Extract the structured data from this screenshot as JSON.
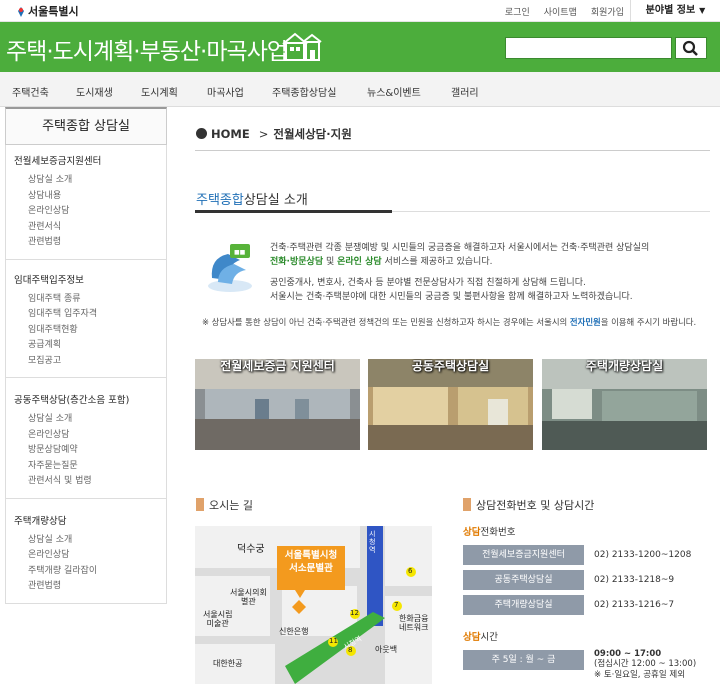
{
  "header": {
    "logo": "서울특별시",
    "site_title": "주택·도시계획·부동산·마곡사업",
    "links": [
      "로그인",
      "사이트맵",
      "회원가입"
    ],
    "info_button": "분야별 정보"
  },
  "nav": [
    "주택건축",
    "도시재생",
    "도시계획",
    "마곡사업",
    "주택종합상담실",
    "뉴스&이벤트",
    "갤러리"
  ],
  "sidebar": {
    "title": "주택종합 상담실",
    "groups": [
      {
        "title": "전월세보증금지원센터",
        "items": [
          "상담실 소개",
          "상담내용",
          "온라인상담",
          "관련서식",
          "관련법령"
        ]
      },
      {
        "title": "임대주택입주정보",
        "items": [
          "임대주택 종류",
          "임대주택 입주자격",
          "임대주택현황",
          "공급계획",
          "모집공고"
        ]
      },
      {
        "title": "공동주택상담(층간소음 포함)",
        "items": [
          "상담실 소개",
          "온라인상담",
          "방문상담예약",
          "자주묻는질문",
          "관련서식 및 법령"
        ]
      },
      {
        "title": "주택개량상담",
        "items": [
          "상담실 소개",
          "온라인상담",
          "주택개량 길라잡이",
          "관련법령"
        ]
      }
    ]
  },
  "breadcrumb": {
    "home": "HOME",
    "sep": ">",
    "current": "전월세상담·지원"
  },
  "section": {
    "title_hl": "주택종합",
    "title_rest": "상담실 소개"
  },
  "intro": {
    "p1a": "건축·주택관련 각종 분쟁예방 및 시민들의 궁금증을 해결하고자 서울시에서는 건축·주택관련 상담실의",
    "p1b_hl1": "전화·방문상담",
    "p1b_mid": " 및 ",
    "p1b_hl2": "온라인 상담",
    "p1b_end": " 서비스를 제공하고 있습니다.",
    "p2": "공인중개사, 변호사, 건축사 등 분야별 전문상담사가 직접 친절하게 상담해 드립니다.",
    "p3": "서울시는 건축·주택분야에 대한 시민들의 궁금증 및 불편사항을 함께 해결하고자 노력하겠습니다."
  },
  "note": {
    "a": "※ 상담사를 통한 상담이 아닌 건축·주택관련 정책건의 또는 민원을 신청하고자 하시는 경우에는 서울시의 ",
    "link": "전자민원",
    "b": "을 이용해 주시기 바랍니다."
  },
  "photos": [
    "전월세보증금 지원센터",
    "공동주택상담실",
    "주택개량상담실"
  ],
  "directions": {
    "title": "오시는 길",
    "labels": {
      "deoksugung": "덕수궁",
      "cityhall": "서울특별시청\n서소문별관",
      "council": "서울시의회\n별관",
      "museum": "서울시립\n미술관",
      "shinhan": "신한은행",
      "hanwha": "한화금융\n네트워크",
      "embassy": "대한한공",
      "ayuback": "아웃백",
      "road1": "시청역",
      "road2": "시청역"
    },
    "exits": [
      "6",
      "7",
      "12",
      "11",
      "8"
    ]
  },
  "contact": {
    "title": "상담전화번호 및 상담시간",
    "phone_title_hl": "상담",
    "phone_title_rest": "전화번호",
    "rows": [
      {
        "label": "전월세보증금지원센터",
        "tel": "02) 2133-1200~1208"
      },
      {
        "label": "공동주택상담실",
        "tel": "02) 2133-1218~9"
      },
      {
        "label": "주택개량상담실",
        "tel": "02) 2133-1216~7"
      }
    ],
    "time_title_hl": "상담",
    "time_title_rest": "시간",
    "days": "주 5일 : 월 ~ 금",
    "hours": "09:00 ~ 17:00",
    "lunch": "(점심시간 12:00 ~ 13:00)",
    "holiday": "※ 토·일요일, 공휴일 제외"
  },
  "colors": {
    "green": "#4cad3c",
    "blue": "#1f6fb6",
    "orange": "#e07a00"
  }
}
